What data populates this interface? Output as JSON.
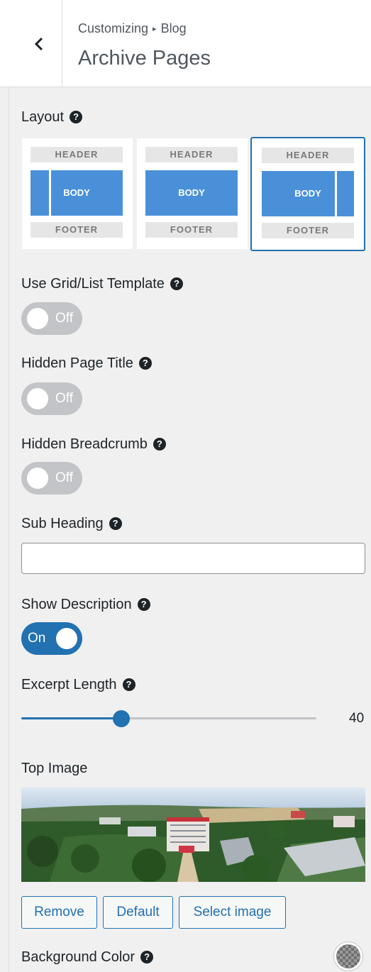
{
  "header": {
    "breadcrumb_parent": "Customizing",
    "breadcrumb_separator": "▸",
    "breadcrumb_child": "Blog",
    "title": "Archive Pages"
  },
  "layout": {
    "label": "Layout",
    "help": "?",
    "options": [
      {
        "header": "HEADER",
        "body": "BODY",
        "footer": "FOOTER",
        "sidebar": "left",
        "selected": false
      },
      {
        "header": "HEADER",
        "body": "BODY",
        "footer": "FOOTER",
        "sidebar": "none",
        "selected": false
      },
      {
        "header": "HEADER",
        "body": "BODY",
        "footer": "FOOTER",
        "sidebar": "right",
        "selected": true
      }
    ]
  },
  "grid_list": {
    "label": "Use Grid/List Template",
    "help": "?",
    "state": "Off"
  },
  "hidden_page_title": {
    "label": "Hidden Page Title",
    "help": "?",
    "state": "Off"
  },
  "hidden_breadcrumb": {
    "label": "Hidden Breadcrumb",
    "help": "?",
    "state": "Off"
  },
  "sub_heading": {
    "label": "Sub Heading",
    "help": "?",
    "value": ""
  },
  "show_description": {
    "label": "Show Description",
    "help": "?",
    "state": "On"
  },
  "excerpt_length": {
    "label": "Excerpt Length",
    "help": "?",
    "value": "40",
    "fraction": 0.34
  },
  "top_image": {
    "label": "Top Image"
  },
  "buttons": {
    "remove": "Remove",
    "default": "Default",
    "select": "Select image"
  },
  "background_color": {
    "label": "Background Color",
    "help": "?"
  },
  "colors": {
    "accent": "#2271b1",
    "toggle_off": "#c3c4c7",
    "layout_body": "#4a90d9"
  }
}
